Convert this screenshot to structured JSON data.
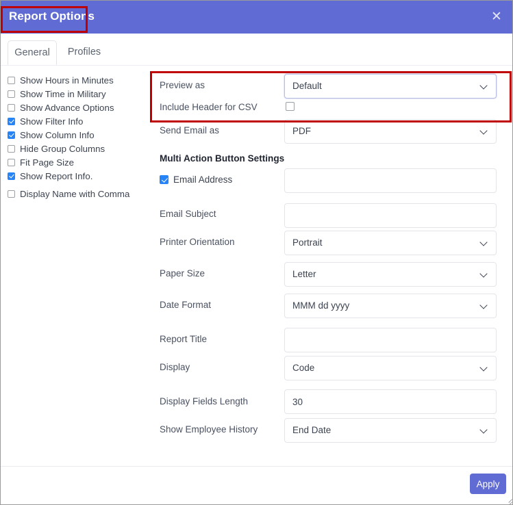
{
  "window": {
    "title": "Report Options",
    "close_icon": "close-icon"
  },
  "tabs": [
    {
      "label": "General",
      "active": true
    },
    {
      "label": "Profiles",
      "active": false
    }
  ],
  "checklist": [
    {
      "label": "Show Hours in Minutes",
      "checked": false
    },
    {
      "label": "Show Time in Military",
      "checked": false
    },
    {
      "label": "Show Advance Options",
      "checked": false
    },
    {
      "label": "Show Filter Info",
      "checked": true
    },
    {
      "label": "Show Column Info",
      "checked": true
    },
    {
      "label": "Hide Group Columns",
      "checked": false
    },
    {
      "label": "Fit Page Size",
      "checked": false
    },
    {
      "label": "Show Report Info.",
      "checked": true
    },
    {
      "label": "Display Name with Comma",
      "checked": false
    }
  ],
  "form": {
    "preview_as": {
      "label": "Preview as",
      "value": "Default",
      "type": "select",
      "focused": true
    },
    "include_header_csv": {
      "label": "Include Header for CSV",
      "checked": false,
      "type": "checkbox"
    },
    "send_email_as": {
      "label": "Send Email as",
      "value": "PDF",
      "type": "select"
    },
    "section_title": "Multi Action Button Settings",
    "email_address": {
      "label": "Email Address",
      "value": "",
      "placeholder": "",
      "checked": true,
      "type": "text-with-checkbox"
    },
    "email_subject": {
      "label": "Email Subject",
      "value": "",
      "placeholder": "",
      "type": "text"
    },
    "printer_orientation": {
      "label": "Printer Orientation",
      "value": "Portrait",
      "type": "select"
    },
    "paper_size": {
      "label": "Paper Size",
      "value": "Letter",
      "type": "select"
    },
    "date_format": {
      "label": "Date Format",
      "value": "MMM dd yyyy",
      "type": "select"
    },
    "report_title": {
      "label": "Report Title",
      "value": "",
      "placeholder": "",
      "type": "text"
    },
    "display": {
      "label": "Display",
      "value": "Code",
      "type": "select"
    },
    "display_fields_length": {
      "label": "Display Fields Length",
      "value": "30",
      "type": "text"
    },
    "show_employee_history": {
      "label": "Show Employee History",
      "value": "End Date",
      "type": "select"
    }
  },
  "footer": {
    "apply_label": "Apply"
  },
  "colors": {
    "header_purple": "#606bd4",
    "checkbox_blue": "#2684f7",
    "annotation_red": "#c00000",
    "label_text": "#4a5160"
  }
}
